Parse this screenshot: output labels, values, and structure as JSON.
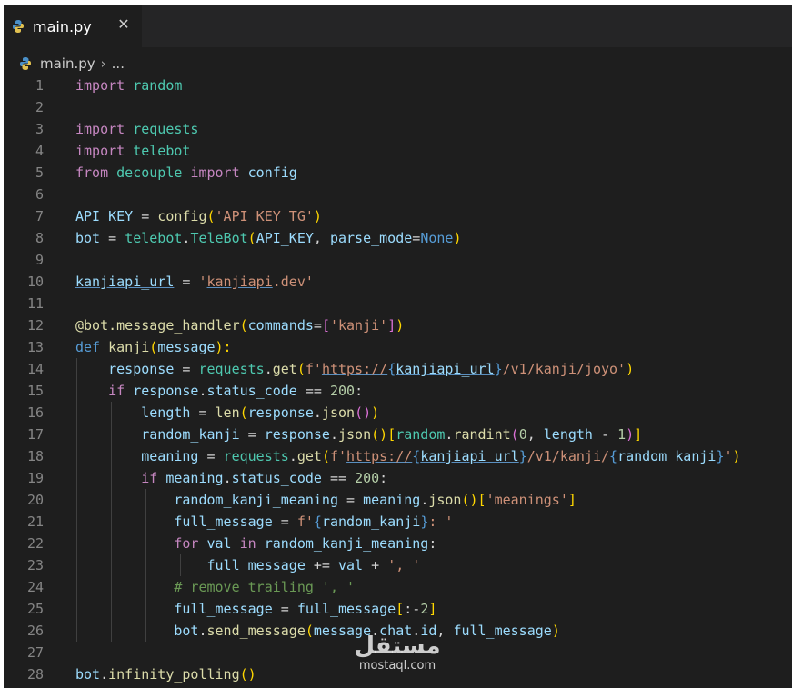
{
  "tab": {
    "label": "main.py",
    "close": "✕"
  },
  "breadcrumb": {
    "file": "main.py",
    "sep": "›",
    "more": "..."
  },
  "colors": {
    "keyword": "#c586c0",
    "function": "#dcdcaa",
    "variable": "#9cdcfe",
    "string": "#ce9178",
    "number": "#b5cea8",
    "class": "#4ec9b0",
    "constant": "#569cd6",
    "comment": "#6a9955",
    "bracket1": "#ffd700",
    "bracket2": "#da70d6",
    "bracket3": "#179fff"
  },
  "lines": [
    [
      [
        "import",
        "kw"
      ],
      [
        " ",
        ""
      ],
      [
        "random",
        "cls"
      ]
    ],
    [],
    [
      [
        "import",
        "kw"
      ],
      [
        " ",
        ""
      ],
      [
        "requests",
        "cls"
      ]
    ],
    [
      [
        "import",
        "kw"
      ],
      [
        " ",
        ""
      ],
      [
        "telebot",
        "cls"
      ]
    ],
    [
      [
        "from",
        "kw"
      ],
      [
        " ",
        ""
      ],
      [
        "decouple",
        "cls"
      ],
      [
        " ",
        ""
      ],
      [
        "import",
        "kw"
      ],
      [
        " ",
        ""
      ],
      [
        "config",
        "var"
      ]
    ],
    [],
    [
      [
        "API_KEY",
        "var"
      ],
      [
        " = ",
        ""
      ],
      [
        "config",
        "fn"
      ],
      [
        "(",
        "b1"
      ],
      [
        "'API_KEY_TG'",
        "str"
      ],
      [
        ")",
        "b1"
      ]
    ],
    [
      [
        "bot",
        "var"
      ],
      [
        " = ",
        ""
      ],
      [
        "telebot",
        "cls"
      ],
      [
        ".",
        ""
      ],
      [
        "TeleBot",
        "cls"
      ],
      [
        "(",
        "b1"
      ],
      [
        "API_KEY",
        "var"
      ],
      [
        ", ",
        ""
      ],
      [
        "parse_mode",
        "var"
      ],
      [
        "=",
        ""
      ],
      [
        "None",
        "const"
      ],
      [
        ")",
        "b1"
      ]
    ],
    [],
    [
      [
        "kanjiapi_url",
        "var u"
      ],
      [
        " = ",
        ""
      ],
      [
        "'",
        "str"
      ],
      [
        "kanjiapi",
        "str u"
      ],
      [
        ".dev'",
        "str"
      ]
    ],
    [],
    [
      [
        "@bot.message_handler",
        "fn"
      ],
      [
        "(",
        "b1"
      ],
      [
        "commands",
        "var"
      ],
      [
        "=",
        ""
      ],
      [
        "[",
        "b2"
      ],
      [
        "'kanji'",
        "str"
      ],
      [
        "]",
        "b2"
      ],
      [
        ")",
        "b1"
      ]
    ],
    [
      [
        "def",
        "const"
      ],
      [
        " ",
        ""
      ],
      [
        "kanji",
        "fn"
      ],
      [
        "(",
        "b1"
      ],
      [
        "message",
        "var"
      ],
      [
        "):",
        "b1"
      ]
    ],
    [
      [
        "    ",
        ""
      ],
      [
        "response",
        "var"
      ],
      [
        " = ",
        ""
      ],
      [
        "requests",
        "cls"
      ],
      [
        ".",
        ""
      ],
      [
        "get",
        "fn"
      ],
      [
        "(",
        "b1"
      ],
      [
        "f'",
        "str"
      ],
      [
        "https://",
        "str u"
      ],
      [
        "{",
        "const"
      ],
      [
        "kanjiapi_url",
        "var u"
      ],
      [
        "}",
        "const"
      ],
      [
        "/v1/kanji/joyo'",
        "str"
      ],
      [
        ")",
        "b1"
      ]
    ],
    [
      [
        "    ",
        ""
      ],
      [
        "if",
        "kw"
      ],
      [
        " ",
        ""
      ],
      [
        "response",
        "var"
      ],
      [
        ".",
        ""
      ],
      [
        "status_code",
        "var"
      ],
      [
        " == ",
        ""
      ],
      [
        "200",
        "num"
      ],
      [
        ":",
        ""
      ]
    ],
    [
      [
        "        ",
        ""
      ],
      [
        "length",
        "var"
      ],
      [
        " = ",
        ""
      ],
      [
        "len",
        "fn"
      ],
      [
        "(",
        "b1"
      ],
      [
        "response",
        "var"
      ],
      [
        ".",
        ""
      ],
      [
        "json",
        "fn"
      ],
      [
        "()",
        "b2"
      ],
      [
        ")",
        "b1"
      ]
    ],
    [
      [
        "        ",
        ""
      ],
      [
        "random_kanji",
        "var"
      ],
      [
        " = ",
        ""
      ],
      [
        "response",
        "var"
      ],
      [
        ".",
        ""
      ],
      [
        "json",
        "fn"
      ],
      [
        "()",
        "b1"
      ],
      [
        "[",
        "b1"
      ],
      [
        "random",
        "cls"
      ],
      [
        ".",
        ""
      ],
      [
        "randint",
        "fn"
      ],
      [
        "(",
        "b2"
      ],
      [
        "0",
        "num"
      ],
      [
        ", ",
        ""
      ],
      [
        "length",
        "var"
      ],
      [
        " - ",
        ""
      ],
      [
        "1",
        "num"
      ],
      [
        ")",
        "b2"
      ],
      [
        "]",
        "b1"
      ]
    ],
    [
      [
        "        ",
        ""
      ],
      [
        "meaning",
        "var"
      ],
      [
        " = ",
        ""
      ],
      [
        "requests",
        "cls"
      ],
      [
        ".",
        ""
      ],
      [
        "get",
        "fn"
      ],
      [
        "(",
        "b1"
      ],
      [
        "f'",
        "str"
      ],
      [
        "https://",
        "str u"
      ],
      [
        "{",
        "const"
      ],
      [
        "kanjiapi_url",
        "var u"
      ],
      [
        "}",
        "const"
      ],
      [
        "/v1/kanji/",
        "str"
      ],
      [
        "{",
        "const"
      ],
      [
        "random_kanji",
        "var"
      ],
      [
        "}",
        "const"
      ],
      [
        "'",
        "str"
      ],
      [
        ")",
        "b1"
      ]
    ],
    [
      [
        "        ",
        ""
      ],
      [
        "if",
        "kw"
      ],
      [
        " ",
        ""
      ],
      [
        "meaning",
        "var"
      ],
      [
        ".",
        ""
      ],
      [
        "status_code",
        "var"
      ],
      [
        " == ",
        ""
      ],
      [
        "200",
        "num"
      ],
      [
        ":",
        ""
      ]
    ],
    [
      [
        "            ",
        ""
      ],
      [
        "random_kanji_meaning",
        "var"
      ],
      [
        " = ",
        ""
      ],
      [
        "meaning",
        "var"
      ],
      [
        ".",
        ""
      ],
      [
        "json",
        "fn"
      ],
      [
        "()",
        "b1"
      ],
      [
        "[",
        "b1"
      ],
      [
        "'meanings'",
        "str"
      ],
      [
        "]",
        "b1"
      ]
    ],
    [
      [
        "            ",
        ""
      ],
      [
        "full_message",
        "var"
      ],
      [
        " = ",
        ""
      ],
      [
        "f'",
        "str"
      ],
      [
        "{",
        "const"
      ],
      [
        "random_kanji",
        "var"
      ],
      [
        "}",
        "const"
      ],
      [
        ": '",
        "str"
      ]
    ],
    [
      [
        "            ",
        ""
      ],
      [
        "for",
        "kw"
      ],
      [
        " ",
        ""
      ],
      [
        "val",
        "var"
      ],
      [
        " ",
        ""
      ],
      [
        "in",
        "kw"
      ],
      [
        " ",
        ""
      ],
      [
        "random_kanji_meaning",
        "var"
      ],
      [
        ":",
        ""
      ]
    ],
    [
      [
        "                ",
        ""
      ],
      [
        "full_message",
        "var"
      ],
      [
        " += ",
        ""
      ],
      [
        "val",
        "var"
      ],
      [
        " + ",
        ""
      ],
      [
        "', '",
        "str"
      ]
    ],
    [
      [
        "            ",
        ""
      ],
      [
        "# remove trailing ', '",
        "cmt"
      ]
    ],
    [
      [
        "            ",
        ""
      ],
      [
        "full_message",
        "var"
      ],
      [
        " = ",
        ""
      ],
      [
        "full_message",
        "var"
      ],
      [
        "[",
        "b1"
      ],
      [
        ":-",
        ""
      ],
      [
        "2",
        "num"
      ],
      [
        "]",
        "b1"
      ]
    ],
    [
      [
        "            ",
        ""
      ],
      [
        "bot",
        "var"
      ],
      [
        ".",
        ""
      ],
      [
        "send_message",
        "fn"
      ],
      [
        "(",
        "b1"
      ],
      [
        "message",
        "var"
      ],
      [
        ".",
        ""
      ],
      [
        "chat",
        "var"
      ],
      [
        ".",
        ""
      ],
      [
        "id",
        "var"
      ],
      [
        ", ",
        ""
      ],
      [
        "full_message",
        "var"
      ],
      [
        ")",
        "b1"
      ]
    ],
    [],
    [
      [
        "bot",
        "var"
      ],
      [
        ".",
        ""
      ],
      [
        "infinity_polling",
        "fn"
      ],
      [
        "()",
        "b1"
      ]
    ]
  ],
  "watermark": {
    "arabic": "مستقل",
    "latin": "mostaql.com"
  }
}
